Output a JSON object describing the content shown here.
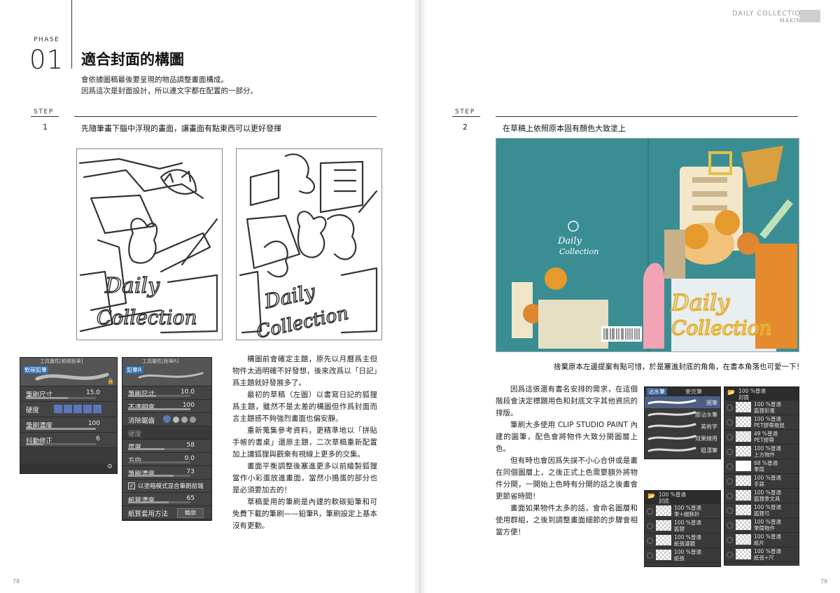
{
  "left": {
    "phase_label": "PHASE",
    "phase_number": "01",
    "title": "適合封面的構圖",
    "lead_lines": [
      "會依據圖稿最後要呈現的物品調整畫面構成。",
      "因爲這次是封面設計，所以連文字都在配置的一部分。"
    ],
    "step": {
      "label": "STEP",
      "number": "1",
      "text": "先隨筆畫下腦中浮現的畫面，讓畫面有點東西可以更好發揮"
    },
    "sketch_text": [
      "Daily",
      "Collection"
    ],
    "brush_panel_1": {
      "header": "工具屬性[軟碳鉛筆]",
      "name": "軟碳鉛筆",
      "rows": [
        {
          "label": "筆刷尺寸",
          "value": "15.0",
          "level": 0.6
        },
        {
          "label": "硬度",
          "value": ""
        },
        {
          "label": "筆刷濃度",
          "value": "100",
          "level": 1.0
        },
        {
          "label": "抖動修正",
          "value": "6",
          "level": 0.25
        }
      ]
    },
    "brush_panel_2": {
      "header": "工具屬性[鉛筆R]",
      "name": "鉛筆R",
      "rows": [
        {
          "label": "筆刷尺寸",
          "value": "10.0",
          "level": 0.45
        },
        {
          "label": "不透明度",
          "value": "100",
          "level": 1.0
        },
        {
          "label": "消除鋸齒",
          "value": ""
        },
        {
          "label": "硬度",
          "value": ""
        },
        {
          "label": "厚度",
          "value": "58",
          "level": 0.58
        },
        {
          "label": "方向",
          "value": "0.0",
          "level": 0.0
        },
        {
          "label": "筆刷濃度",
          "value": "73",
          "level": 0.73
        },
        {
          "label": "以塗暗模式混合筆刷前端",
          "value": ""
        },
        {
          "label": "紙質濃度",
          "value": "65",
          "level": 0.65
        },
        {
          "label": "紙質套用方法",
          "value": "輪廓"
        }
      ]
    },
    "body": [
      "構圖前會確定主題，原先以月曆爲主但物件太過明確不好發想，後來改爲以「日記」爲主題就好發展多了。",
      "最初的草稿（左圖）以書寫日記的狐狸爲主題，雖然不是太差的構圖但作爲封面而言主題感不夠強烈畫面也偏安靜。",
      "重新蒐集參考資料，更精準地以「拼貼手帳的書桌」還原主題，二次草稿重新配置加上讓狐狸與觀衆有視線上更多的交集。",
      "畫面平衡調整後塞進更多以前繪製狐狸當作小彩蛋放進畫面，當然小搗蛋的部分也是必須要加去的！",
      "草稿愛用的筆刷是內建的軟碳鉛筆和可免費下載的筆刷——鉛筆R，筆刷設定上基本沒有更動。"
    ],
    "page_number": "78"
  },
  "right": {
    "running_title": "DAILY COLLECTION",
    "running_sub": "MAKING",
    "step": {
      "label": "STEP",
      "number": "2",
      "text": "在草稿上依照原本固有顏色大致塗上"
    },
    "cover_text": [
      "Daily",
      "Collection"
    ],
    "caption": "捨棄原本左邊提案有點可惜，於是塞進封底的角角，在書本角落也可愛一下！",
    "body": [
      "因爲這張還有書名安排的需求，在這個階段會決定標題用色和封底文字其他資訊的排版。",
      "筆刷大多使用 CLIP STUDIO PAINT 內建的圓筆，配色會將物件大致分開圖層上色。",
      "但有時也會因爲失誤不小心合併或是畫在同個圖層上，之後正式上色需要額外將物件分開，一開始上色時有分開的話之後畫會更節省時間！",
      "畫面如果物件太多的話，會命名圖層和使用群組，之後到調整畫面細節的步驟會相當方便！"
    ],
    "brush_list": {
      "tabs": [
        "沾水筆",
        "麥克筆"
      ],
      "items": [
        "圓筆",
        "膠沾水筆",
        "美術字",
        "效果線用",
        "粗漂筆"
      ]
    },
    "layers_small": {
      "group": "100 %普通\n封底",
      "items": [
        "100 %普通\n筆+綴飾針",
        "100 %普通\n狐狸",
        "100 %普通\n紙張濾鏡",
        "100 %普通\n紙張"
      ]
    },
    "layers_big": {
      "group": "100 %普通\n封面",
      "items": [
        "100 %普通\n狐狸彩蛋",
        "100 %普通\nPET膠帶撥鼠",
        "49 %普通\nPET膠帶",
        "100 %普通\n上方物件",
        "68 %普通\n筆筒",
        "100 %普通\n手錶",
        "100 %普通\n狐狸拿文具",
        "100 %普通\n狐狸弓",
        "100 %普通\n筆筒物件",
        "100 %普通\n紙片",
        "100 %普通\n紙張+尺"
      ]
    },
    "page_number": "79"
  }
}
